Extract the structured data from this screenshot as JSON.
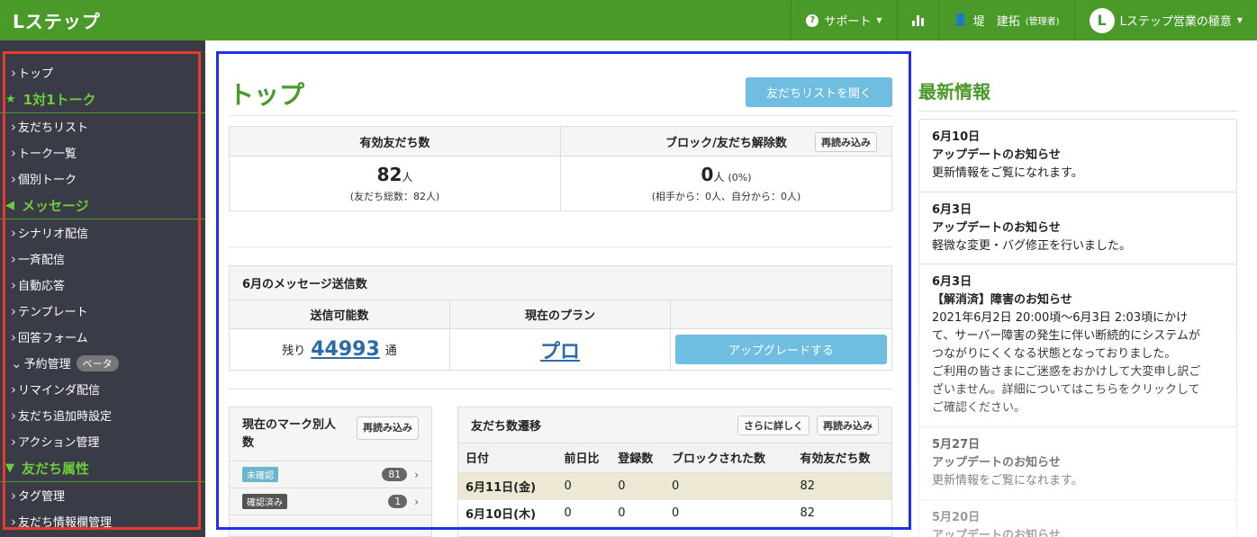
{
  "topbar": {
    "logo": "Lステップ",
    "support": "サポート",
    "user": "堤　建拓",
    "user_role": "(管理者)",
    "account_initial": "L",
    "account": "Lステップ営業の極意"
  },
  "sidebar": {
    "items": [
      {
        "type": "item",
        "label": "トップ"
      },
      {
        "type": "head",
        "label": "1対1トーク",
        "icon": "star-icon"
      },
      {
        "type": "item",
        "label": "友だちリスト"
      },
      {
        "type": "item",
        "label": "トーク一覧"
      },
      {
        "type": "item",
        "label": "個別トーク"
      },
      {
        "type": "head",
        "label": "メッセージ",
        "icon": "megaphone-icon"
      },
      {
        "type": "item",
        "label": "シナリオ配信"
      },
      {
        "type": "item",
        "label": "一斉配信"
      },
      {
        "type": "item",
        "label": "自動応答"
      },
      {
        "type": "item",
        "label": "テンプレート"
      },
      {
        "type": "item",
        "label": "回答フォーム"
      },
      {
        "type": "item",
        "label": "予約管理",
        "badge": "ベータ",
        "expanded": true
      },
      {
        "type": "item",
        "label": "リマインダ配信"
      },
      {
        "type": "item",
        "label": "友だち追加時設定"
      },
      {
        "type": "item",
        "label": "アクション管理"
      },
      {
        "type": "head",
        "label": "友だち属性",
        "icon": "filter-icon"
      },
      {
        "type": "item",
        "label": "タグ管理"
      },
      {
        "type": "item",
        "label": "友だち情報欄管理"
      }
    ]
  },
  "main": {
    "title": "トップ",
    "open_list_button": "友だちリストを開く",
    "friends": {
      "active_label": "有効友だち数",
      "active_count": "82",
      "unit": "人",
      "active_sub": "(友だち総数：82人)",
      "block_label": "ブロック/友だち解除数",
      "reload": "再読み込み",
      "block_count": "0",
      "block_pct": "(0%)",
      "block_sub": "(相手から：0人、自分から：0人)"
    },
    "messages": {
      "title": "6月のメッセージ送信数",
      "sendable_label": "送信可能数",
      "plan_label": "現在のプラン",
      "remaining_prefix": "残り",
      "remaining": "44993",
      "remaining_unit": "通",
      "plan": "プロ",
      "upgrade": "アップグレードする"
    },
    "marks": {
      "title": "現在のマーク別人数",
      "reload": "再読み込み",
      "rows": [
        {
          "label": "未確認",
          "count": "81",
          "color": "#6bb6cc"
        },
        {
          "label": "確認済み",
          "count": "1",
          "color": "#555555"
        }
      ]
    },
    "trend": {
      "title": "友だち数遷移",
      "more": "さらに詳しく",
      "reload": "再読み込み",
      "columns": [
        "日付",
        "前日比",
        "登録数",
        "ブロックされた数",
        "有効友だち数"
      ],
      "rows": [
        [
          "6月11日(金)",
          "0",
          "0",
          "0",
          "82"
        ],
        [
          "6月10日(木)",
          "0",
          "0",
          "0",
          "82"
        ]
      ]
    }
  },
  "news": {
    "title": "最新情報",
    "cards": [
      {
        "date": "6月10日",
        "title": "アップデートのお知らせ",
        "lines": [
          "更新情報をご覧になれます。"
        ]
      },
      {
        "date": "6月3日",
        "title": "アップデートのお知らせ",
        "lines": [
          "軽微な変更・バグ修正を行いました。"
        ]
      },
      {
        "date": "6月3日",
        "title": "【解消済】障害のお知らせ",
        "lines": [
          "2021年6月2日 20:00頃〜6月3日 2:03頃にかけ",
          "て、サーバー障害の発生に伴い断続的にシステムが",
          "つながりにくくなる状態となっておりました。",
          "ご利用の皆さまにご迷惑をおかけして大変申し訳ご",
          "ざいません。詳細についてはこちらをクリックして",
          "ご確認ください。"
        ]
      },
      {
        "date": "5月27日",
        "title": "アップデートのお知らせ",
        "lines": [
          "更新情報をご覧になれます。"
        ]
      },
      {
        "date": "5月20日",
        "title": "アップデートのお知らせ",
        "lines": []
      }
    ]
  }
}
